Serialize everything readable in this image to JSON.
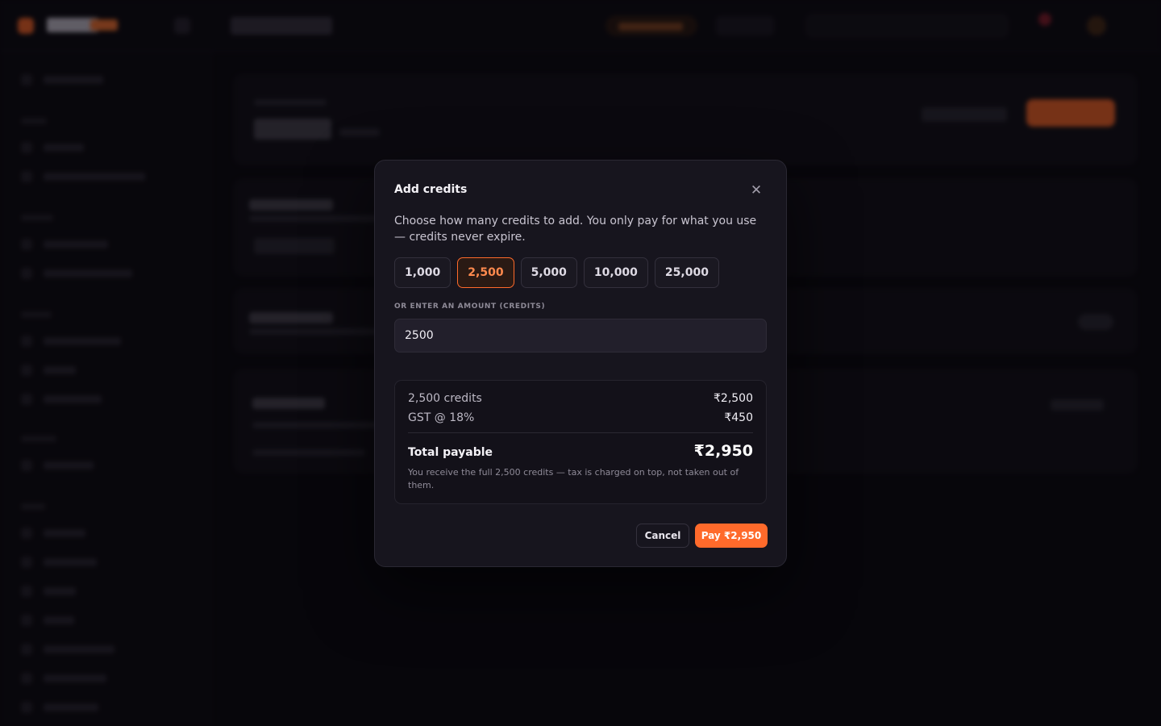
{
  "modal": {
    "title": "Add credits",
    "close_icon": "close-icon",
    "description": "Choose how many credits to add. You only pay for what you use — credits never expire.",
    "presets": [
      "1,000",
      "2,500",
      "5,000",
      "10,000",
      "25,000"
    ],
    "selected_preset": "2,500",
    "amount_label": "OR ENTER AN AMOUNT (CREDITS)",
    "amount_value": "2500",
    "summary": {
      "credits_label": "2,500 credits",
      "credits_value": "₹2,500",
      "gst_label": "GST @ 18%",
      "gst_value": "₹450",
      "total_label": "Total payable",
      "total_value": "₹2,950",
      "note": "You receive the full 2,500 credits — tax is charged on top, not taken out of them."
    },
    "cancel_label": "Cancel",
    "pay_label": "Pay ₹2,950"
  },
  "colors": {
    "accent": "#ff6a2b",
    "modal_bg": "#17151e",
    "page_bg": "#0b0a10"
  }
}
